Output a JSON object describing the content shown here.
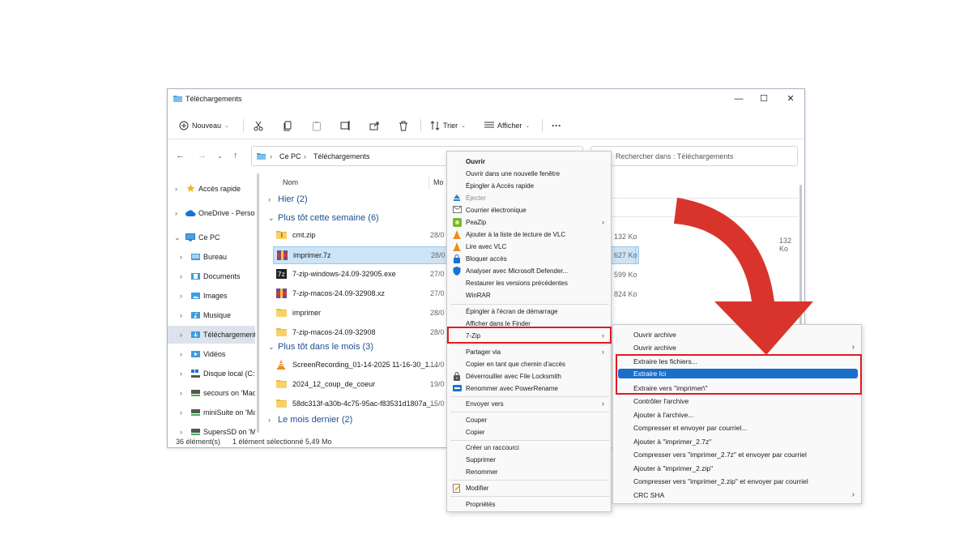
{
  "window": {
    "title": "Téléchargements",
    "controls": {
      "minimize": "—",
      "maximize": "☐",
      "close": "✕"
    }
  },
  "toolbar": {
    "new_label": "Nouveau",
    "sort_label": "Trier",
    "view_label": "Afficher",
    "more_label": "···"
  },
  "address": {
    "root": "Ce PC",
    "current": "Téléchargements",
    "search_placeholder": "Rechercher dans : Téléchargements"
  },
  "nav": {
    "items": [
      {
        "label": "Accès rapide"
      },
      {
        "label": "OneDrive - Perso"
      },
      {
        "label": "Ce PC"
      },
      {
        "label": "Bureau"
      },
      {
        "label": "Documents"
      },
      {
        "label": "Images"
      },
      {
        "label": "Musique"
      },
      {
        "label": "Téléchargements"
      },
      {
        "label": "Vidéos"
      },
      {
        "label": "Disque local (C:)"
      },
      {
        "label": "secours on 'Mac'"
      },
      {
        "label": "miniSuite on 'Mac'"
      },
      {
        "label": "SupersSD on 'Mac'"
      }
    ]
  },
  "files": {
    "columns": {
      "name": "Nom",
      "modified": "Mo"
    },
    "groups": [
      {
        "label": "Hier (2)"
      },
      {
        "label": "Plus tôt cette semaine (6)"
      },
      {
        "label": "Plus tôt dans le mois (3)"
      },
      {
        "label": "Le mois dernier (2)"
      }
    ],
    "rows": [
      {
        "name": "cmt.zip",
        "date": "28/0"
      },
      {
        "name": "imprimer.7z",
        "date": "28/0"
      },
      {
        "name": "7-zip-windows-24.09-32905.exe",
        "date": "27/0"
      },
      {
        "name": "7-zip-macos-24.09-32908.xz",
        "date": "27/0"
      },
      {
        "name": "imprimer",
        "date": "28/0"
      },
      {
        "name": "7-zip-macos-24.09-32908",
        "date": "28/0"
      },
      {
        "name": "ScreenRecording_01-14-2025 11-16-30_1....",
        "date": "14/0"
      },
      {
        "name": "2024_12_coup_de_coeur",
        "date": "19/0"
      },
      {
        "name": "58dc313f-a30b-4c75-95ac-f83531d1807a_...",
        "date": "15/0"
      }
    ],
    "sizes": [
      "132 Ko",
      "627 Ko",
      "599 Ko",
      "824 Ko"
    ]
  },
  "status": {
    "count": "36 élément(s)",
    "selected": "1 élément sélectionné",
    "size": "5,49 Mo"
  },
  "context_menu": {
    "items": [
      {
        "label": "Ouvrir"
      },
      {
        "label": "Ouvrir dans une nouvelle fenêtre"
      },
      {
        "label": "Épingler à Accès rapide"
      },
      {
        "label": "Éjecter"
      },
      {
        "label": "Courrier électronique"
      },
      {
        "label": "PeaZip"
      },
      {
        "label": "Ajouter à la liste de lecture de VLC"
      },
      {
        "label": "Lire avec VLC"
      },
      {
        "label": "Bloquer accès"
      },
      {
        "label": "Analyser avec Microsoft Defender..."
      },
      {
        "label": "Restaurer les versions précédentes"
      },
      {
        "label": "WinRAR"
      },
      {
        "label": "Épingler à l'écran de démarrage"
      },
      {
        "label": "Afficher dans le Finder"
      },
      {
        "label": "7-Zip"
      },
      {
        "label": "Partager via"
      },
      {
        "label": "Copier en tant que chemin d'accès"
      },
      {
        "label": "Déverrouiller avec File Locksmith"
      },
      {
        "label": "Renommer avec PowerRename"
      },
      {
        "label": "Envoyer vers"
      },
      {
        "label": "Couper"
      },
      {
        "label": "Copier"
      },
      {
        "label": "Créer un raccourci"
      },
      {
        "label": "Supprimer"
      },
      {
        "label": "Renommer"
      },
      {
        "label": "Modifier"
      },
      {
        "label": "Propriétés"
      }
    ]
  },
  "submenu_7zip": {
    "items": [
      {
        "label": "Ouvrir archive"
      },
      {
        "label": "Ouvrir archive"
      },
      {
        "label": "Extraire les fichiers..."
      },
      {
        "label": "Extraire Ici"
      },
      {
        "label": "Extraire vers \"imprimer\\\""
      },
      {
        "label": "Contrôler l'archive"
      },
      {
        "label": "Ajouter à l'archive..."
      },
      {
        "label": "Compresser et envoyer par courriel..."
      },
      {
        "label": "Ajouter à \"imprimer_2.7z\""
      },
      {
        "label": "Compresser vers \"imprimer_2.7z\" et envoyer par courriel"
      },
      {
        "label": "Ajouter à \"imprimer_2.zip\""
      },
      {
        "label": "Compresser vers \"imprimer_2.zip\" et envoyer par courriel"
      },
      {
        "label": "CRC SHA"
      }
    ]
  },
  "colors": {
    "highlight_outline": "#e01b24",
    "arrow": "#d9342b",
    "active_item": "#1a6fc9",
    "selected_row": "#cde4f7",
    "group_header": "#1d4f91"
  },
  "icons": {
    "arrow": "curved-arrow-icon",
    "folder": "folder-icon"
  }
}
